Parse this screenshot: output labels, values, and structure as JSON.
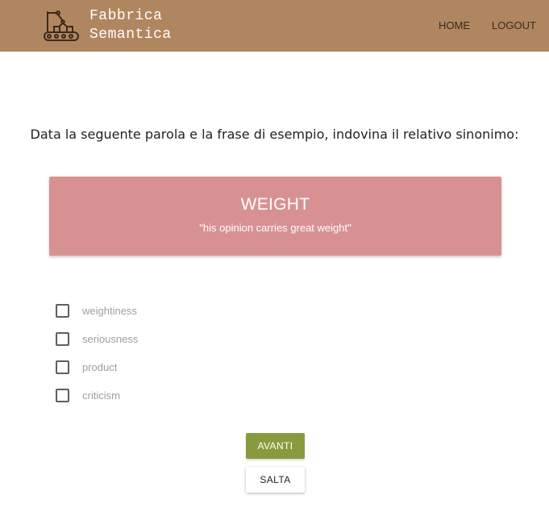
{
  "navbar": {
    "brand_line1": "Fabbrica",
    "brand_line2": "Semantica",
    "logo_icon": "factory-robot-arm-icon",
    "home_label": "HOME",
    "logout_label": "LOGOUT",
    "background_color": "#b08660"
  },
  "quiz": {
    "question": "Data la seguente parola e la frase di esempio, indovina il relativo sinonimo:",
    "word": "WEIGHT",
    "example": "\"his opinion carries great weight\"",
    "card_color": "#d89193",
    "options": [
      {
        "label": "weightiness",
        "checked": false
      },
      {
        "label": "seriousness",
        "checked": false
      },
      {
        "label": "product",
        "checked": false
      },
      {
        "label": "criticism",
        "checked": false
      }
    ]
  },
  "actions": {
    "next_label": "AVANTI",
    "skip_label": "SALTA",
    "next_color": "#889a3e"
  }
}
